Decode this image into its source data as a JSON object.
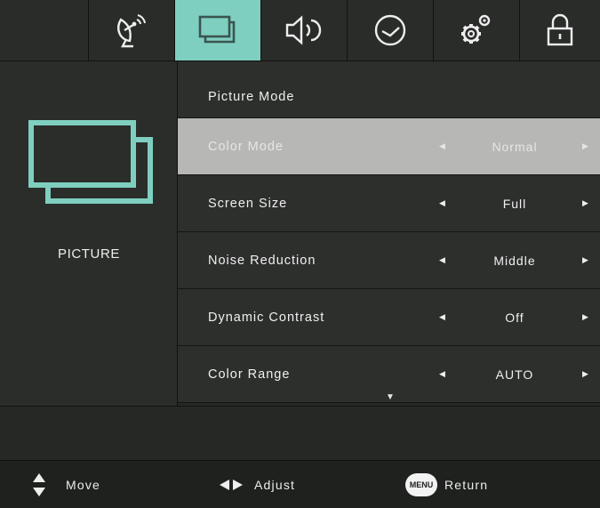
{
  "tabs": [
    {
      "name": "tab-channel",
      "icon": "satellite-dish-icon"
    },
    {
      "name": "tab-picture",
      "icon": "picture-icon",
      "active": true
    },
    {
      "name": "tab-sound",
      "icon": "speaker-icon"
    },
    {
      "name": "tab-time",
      "icon": "clock-icon"
    },
    {
      "name": "tab-setup",
      "icon": "gear-icon"
    },
    {
      "name": "tab-lock",
      "icon": "padlock-icon"
    }
  ],
  "left_panel": {
    "icon": "picture-icon",
    "label": "PICTURE"
  },
  "scroll": {
    "up_icon": "▲",
    "down_icon": "▼"
  },
  "menu_items": [
    {
      "label": "Picture Mode",
      "value": ""
    },
    {
      "label": "Color Mode",
      "value": "Normal",
      "selected": true
    },
    {
      "label": "Screen Size",
      "value": "Full"
    },
    {
      "label": "Noise Reduction",
      "value": "Middle"
    },
    {
      "label": "Dynamic Contrast",
      "value": "Off"
    },
    {
      "label": "Color Range",
      "value": "AUTO"
    }
  ],
  "footer": {
    "move_label": "Move",
    "adjust_label": "Adjust",
    "menu_badge": "MENU",
    "return_label": "Return"
  },
  "colors": {
    "accent": "#7fcfc0",
    "highlight_row": "#b7b7b5",
    "background": "#262826"
  }
}
